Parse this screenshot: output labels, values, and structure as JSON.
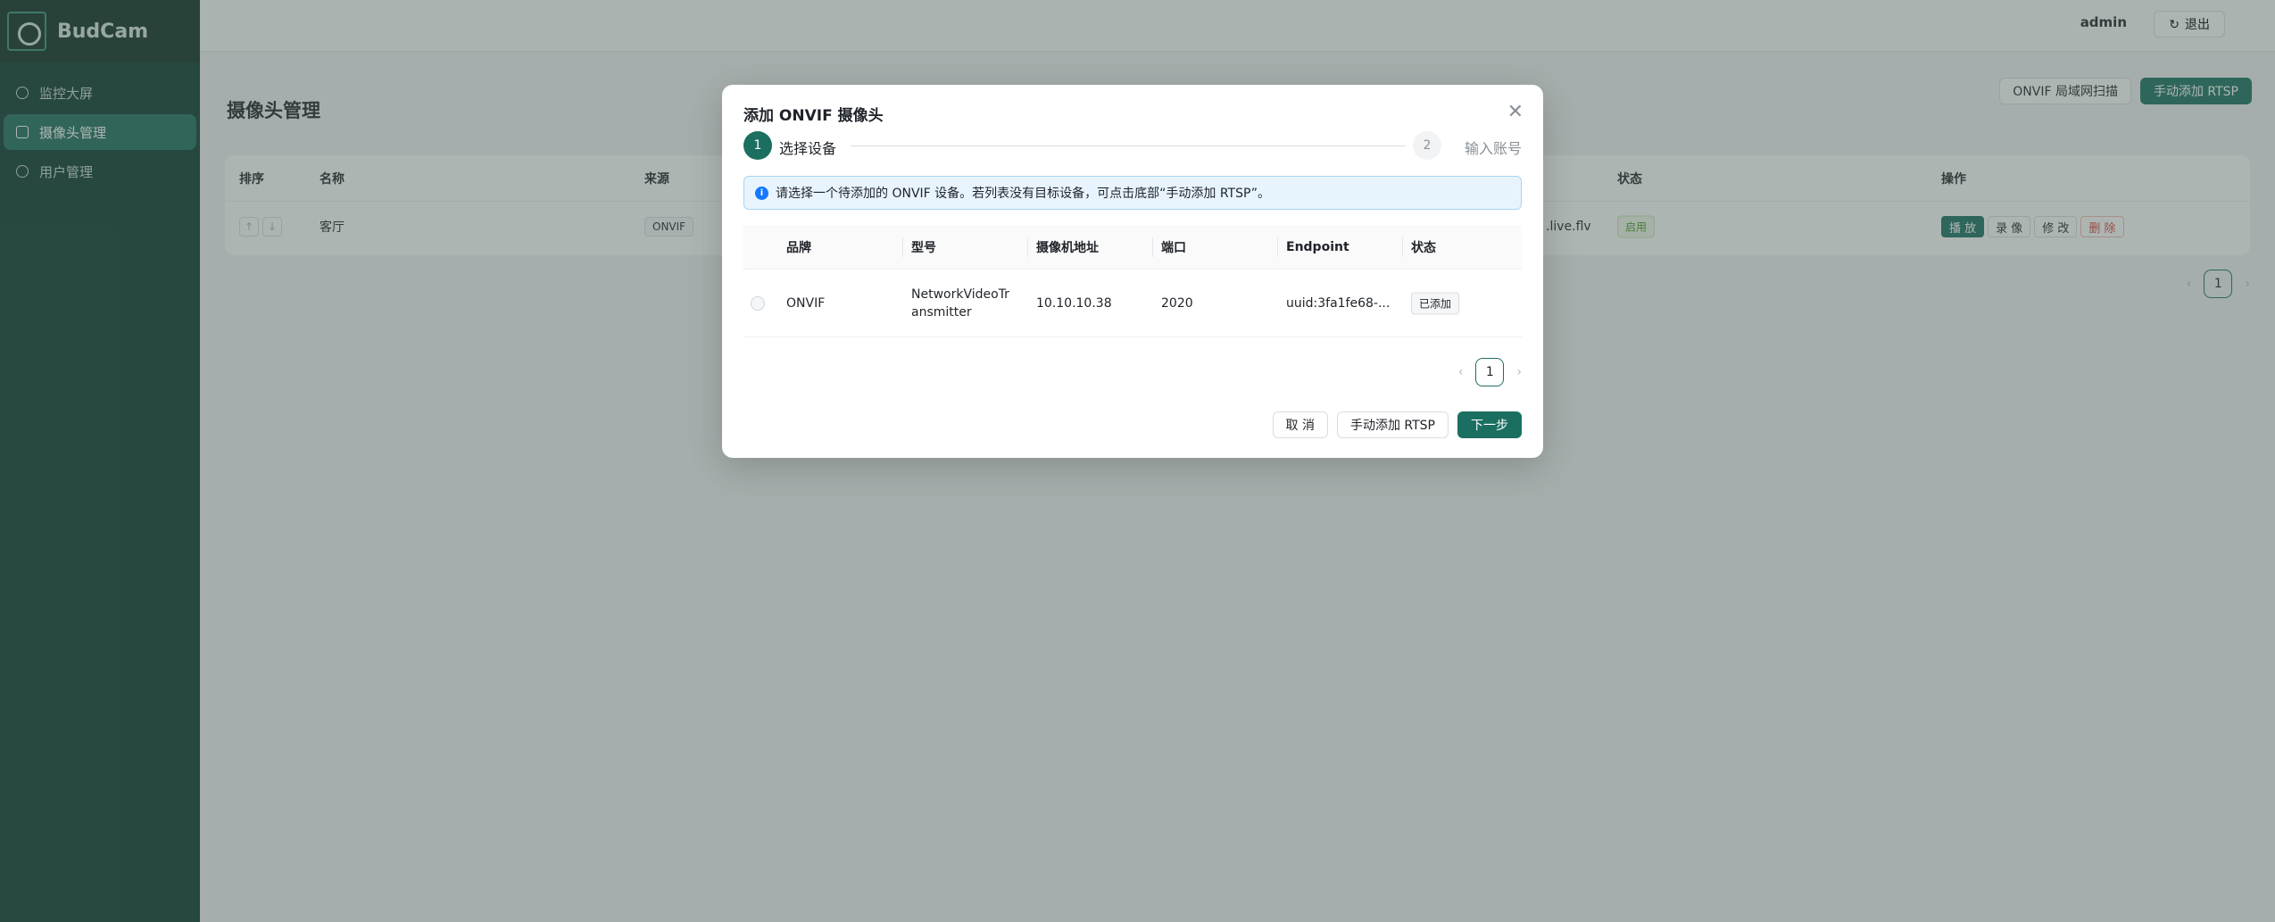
{
  "app": {
    "name": "BudCam"
  },
  "sidebar": {
    "items": [
      {
        "label": "监控大屏",
        "active": false
      },
      {
        "label": "摄像头管理",
        "active": true
      },
      {
        "label": "用户管理",
        "active": false
      }
    ]
  },
  "header": {
    "user": "admin",
    "logout_label": "退出"
  },
  "page": {
    "title": "摄像头管理",
    "scan_label": "ONVIF 局域网扫描",
    "add_rtsp_label": "手动添加 RTSP",
    "columns": [
      "排序",
      "名称",
      "来源",
      "状态",
      "操作"
    ],
    "row": {
      "name": "客厅",
      "source": "ONVIF",
      "url_tail": ".live.flv",
      "status": "启用",
      "actions": [
        "播 放",
        "录 像",
        "修 改",
        "删 除"
      ]
    },
    "pager": {
      "current": "1"
    }
  },
  "modal": {
    "title": "添加 ONVIF 摄像头",
    "steps": [
      {
        "num": "1",
        "label": "选择设备"
      },
      {
        "num": "2",
        "label": "输入账号"
      }
    ],
    "alert": "请选择一个待添加的 ONVIF 设备。若列表没有目标设备，可点击底部“手动添加 RTSP”。",
    "columns": [
      "品牌",
      "型号",
      "摄像机地址",
      "端口",
      "Endpoint",
      "状态"
    ],
    "rows": [
      {
        "brand": "ONVIF",
        "model": "NetworkVideoTransmitter",
        "address": "10.10.10.38",
        "port": "2020",
        "endpoint": "uuid:3fa1fe68-...",
        "status": "已添加"
      }
    ],
    "pager": {
      "current": "1"
    },
    "footer": {
      "cancel": "取 消",
      "manual": "手动添加 RTSP",
      "next": "下一步"
    }
  },
  "colors": {
    "primary": "#1b6f61",
    "sidebar": "#0c3a30"
  }
}
